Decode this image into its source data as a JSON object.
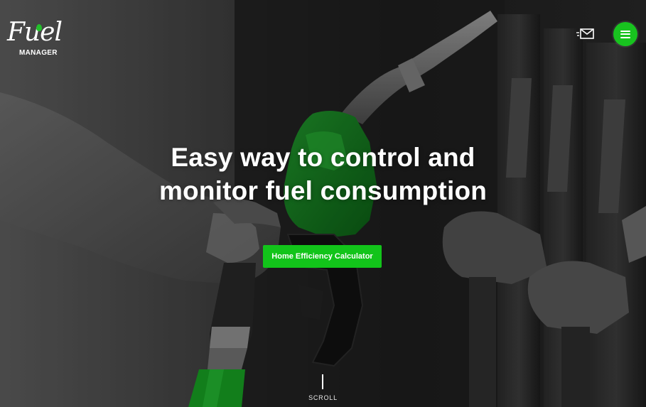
{
  "brand": {
    "logo_word": "Fuel",
    "logo_subtitle": "MANAGER",
    "accent_color": "#12c41a"
  },
  "header": {
    "mail_icon": "mail-icon",
    "menu_icon": "hamburger-menu-icon"
  },
  "hero": {
    "headline_line1": "Easy way to control and",
    "headline_line2": "monitor fuel consumption",
    "cta_label": "Home Efficiency Calculator",
    "scroll_label": "SCROLL"
  }
}
